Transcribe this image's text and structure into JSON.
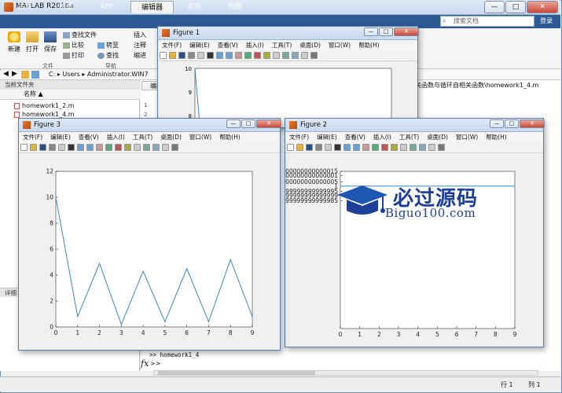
{
  "app": {
    "title": "MATLAB R2018a",
    "window_controls": {
      "minimize": "—",
      "maximize": "□",
      "close": "✕"
    },
    "login": "登录",
    "search_placeholder": "搜索文档"
  },
  "ribbon_tabs": [
    {
      "label": "主页"
    },
    {
      "label": "绘图"
    },
    {
      "label": "APP"
    },
    {
      "label": "编辑器"
    },
    {
      "label": "发布"
    },
    {
      "label": "视图"
    }
  ],
  "toolstrip": {
    "new": "新建",
    "open": "打开",
    "save": "保存",
    "find_files": "查找文件",
    "compare": "比较",
    "print": "打印",
    "goto": "转至",
    "find": "查找",
    "insert": "插入",
    "comment": "注释",
    "indent": "缩进",
    "section_file": "文件",
    "section_nav": "导航"
  },
  "address": {
    "path": "C: ▸ Users ▸ Administrator.WIN7"
  },
  "file_panel": {
    "title": "当前文件夹",
    "column_header": "名称 ▲",
    "files": [
      "homework1_2.m",
      "homework1_4.m"
    ],
    "details": "详细"
  },
  "editor": {
    "tab": "编辑",
    "path_fragment": "关函数与循环自相关函数\\homework1_4.m",
    "line_numbers": [
      "1",
      "2"
    ]
  },
  "command": {
    "prompt_line": ">> homework1_4",
    "fx": "fx",
    "prompt": ">>"
  },
  "status": {
    "row_label": "行 1",
    "col_label": "列 1"
  },
  "figure_menu": [
    "文件(F)",
    "编辑(E)",
    "查看(V)",
    "插入(I)",
    "工具(T)",
    "桌面(D)",
    "窗口(W)",
    "帮助(H)"
  ],
  "figures": {
    "figure1": {
      "title": "Figure 1",
      "yticks": [
        "10",
        "9",
        "8"
      ]
    },
    "figure2": {
      "title": "Figure 2"
    },
    "figure3": {
      "title": "Figure 3"
    }
  },
  "chart_data": [
    {
      "type": "line",
      "figure": "Figure 3",
      "x": [
        0,
        1,
        2,
        3,
        4,
        5,
        6,
        7,
        8,
        9
      ],
      "y": [
        10,
        0.8,
        4.9,
        0.2,
        4.3,
        0.4,
        4.5,
        0.4,
        5.2,
        0.8
      ],
      "xlim": [
        0,
        9
      ],
      "ylim": [
        0,
        12
      ],
      "xticks": [
        "0",
        "1",
        "2",
        "3",
        "4",
        "5",
        "6",
        "7",
        "8",
        "9"
      ],
      "yticks": [
        "0",
        "2",
        "4",
        "6",
        "8",
        "10",
        "12"
      ],
      "line_color": "#3a87c3"
    },
    {
      "type": "line",
      "figure": "Figure 2",
      "x": [
        0,
        9
      ],
      "y": [
        1,
        1
      ],
      "xlim": [
        0,
        9
      ],
      "ylim": [
        0.999999999999985,
        1.0000000000000016
      ],
      "xticks": [
        "0",
        "1",
        "2",
        "3",
        "4",
        "5",
        "6",
        "7",
        "8",
        "9"
      ],
      "yticks": [
        "1.0000000000000015",
        "1.000000000000001",
        "1.0000000000000005",
        "1",
        "0.9999999999999995",
        "0.999999999999999",
        "0.9999999999999985"
      ],
      "line_color": "#3a87c3"
    }
  ],
  "watermark": {
    "cn": "必过源码",
    "en": "Biguo100.com"
  }
}
